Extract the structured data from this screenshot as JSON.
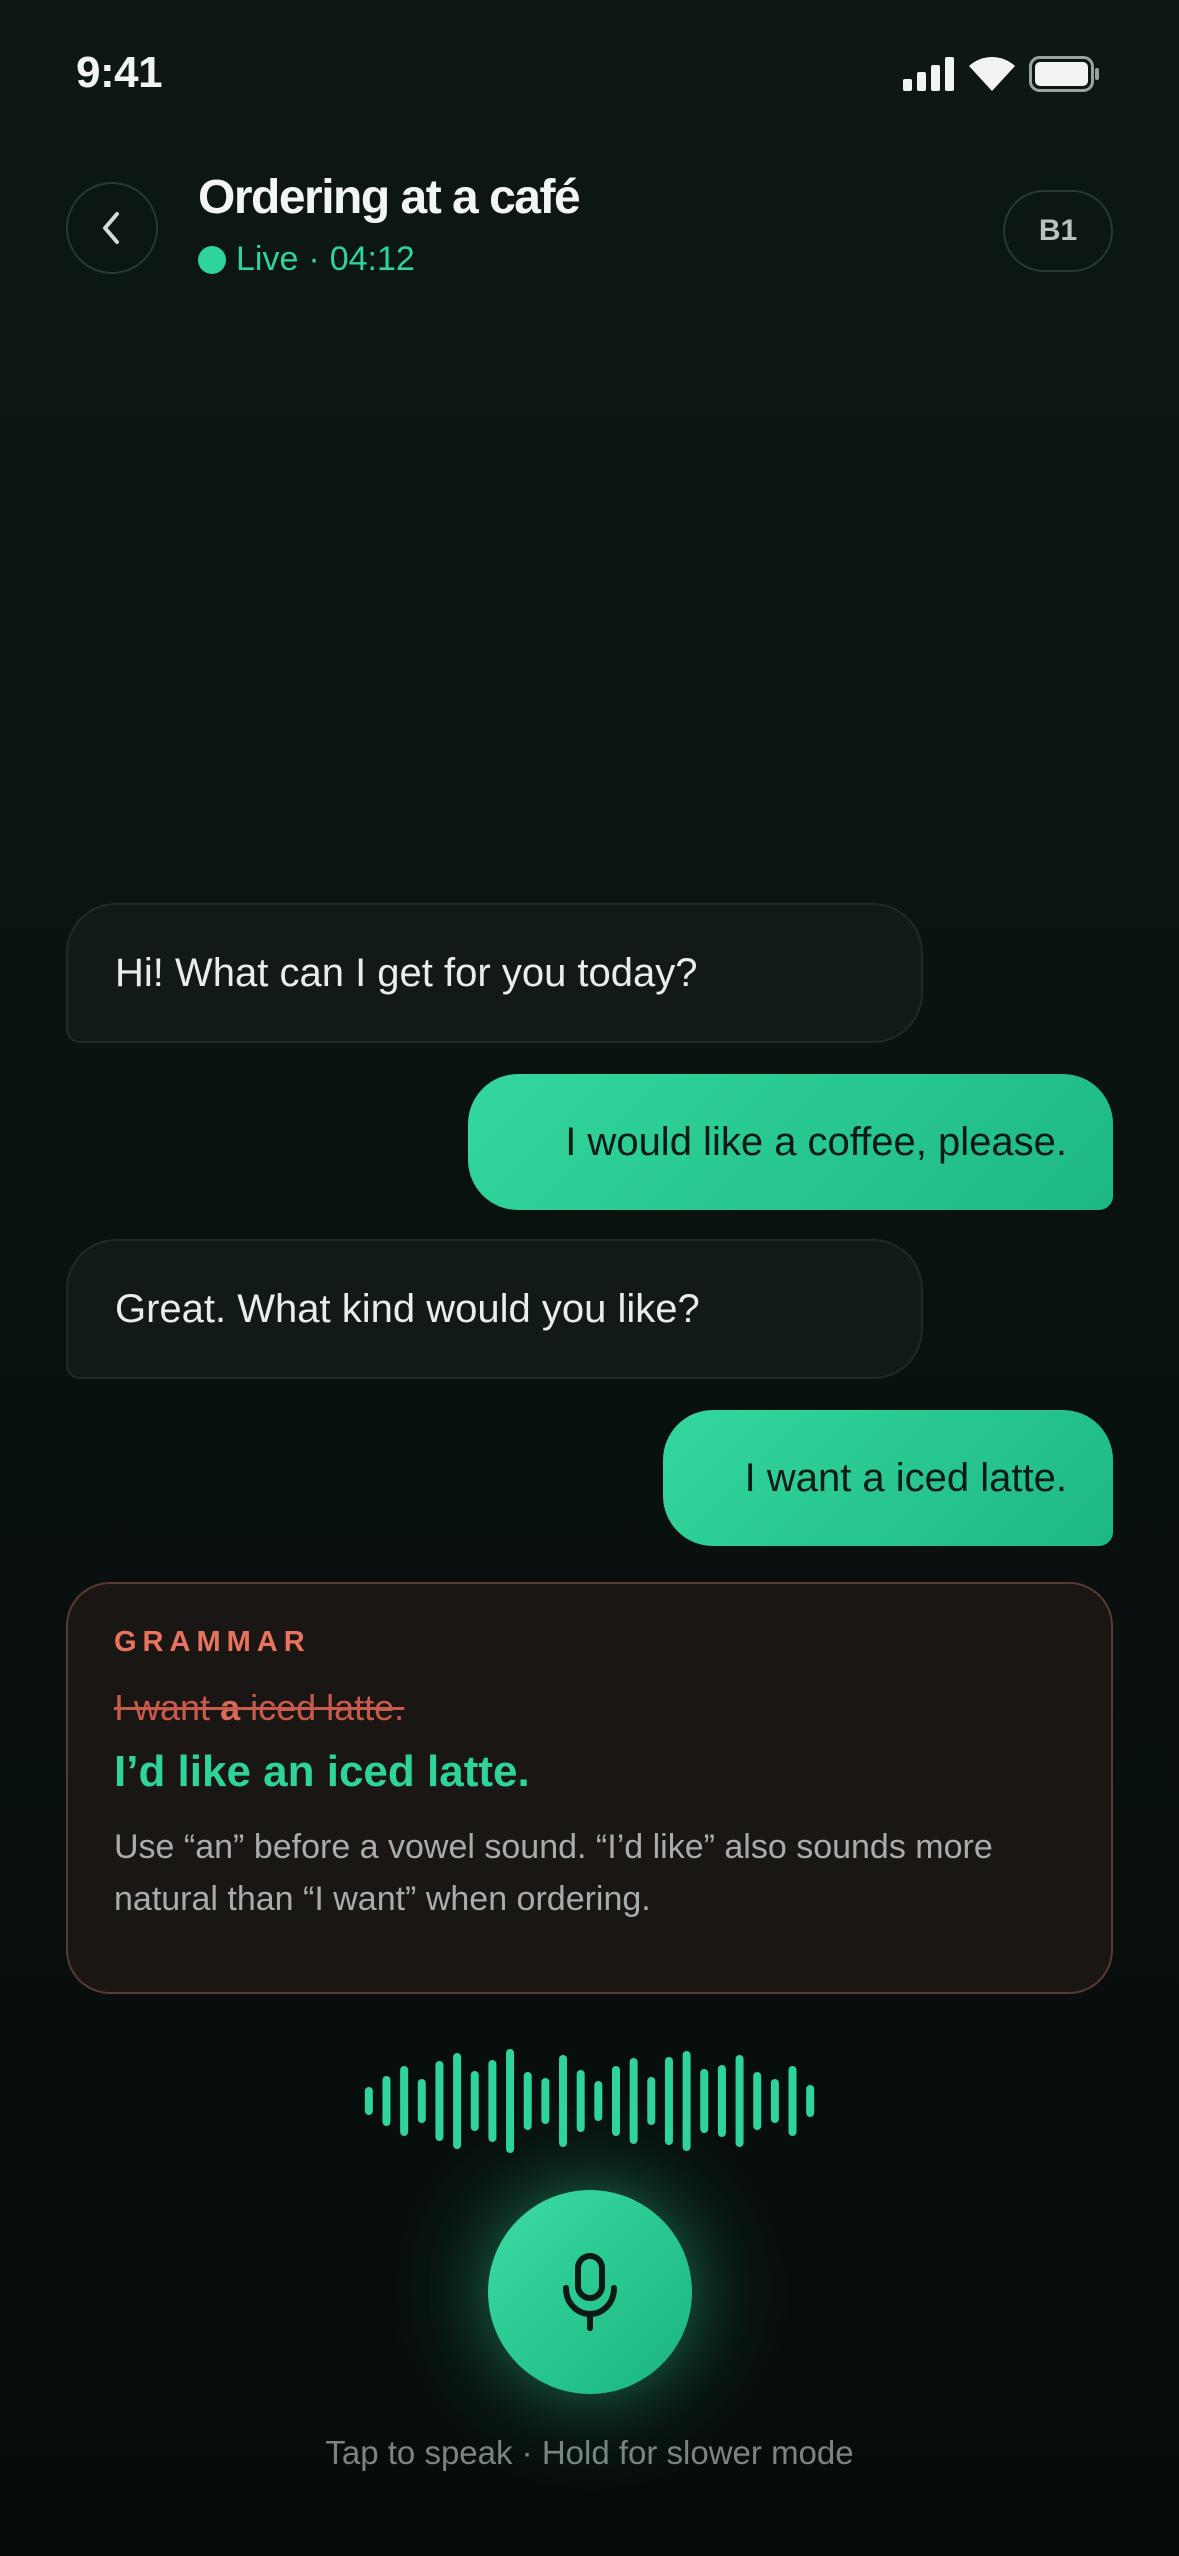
{
  "status_bar": {
    "time": "9:41"
  },
  "header": {
    "title": "Ordering at a café",
    "live_label": "Live",
    "separator": "·",
    "timer": "04:12",
    "level": "B1"
  },
  "messages": [
    {
      "role": "tutor",
      "text": "Hi! What can I get for you today?"
    },
    {
      "role": "user",
      "text": "I would like a coffee, please."
    },
    {
      "role": "tutor",
      "text": "Great. What kind would you like?"
    },
    {
      "role": "user",
      "text": "I want a iced latte."
    }
  ],
  "grammar": {
    "label": "GRAMMAR",
    "wrong_before": "I want ",
    "wrong_highlight": "a",
    "wrong_after": " iced latte.",
    "correction": "I’d like an iced latte.",
    "explanation_line1": "Use “an” before a vowel sound. “I’d like” also sounds more",
    "explanation_line2": "natural than “I want” when ordering."
  },
  "voice": {
    "hint": "Tap to speak · Hold for slower mode"
  },
  "colors": {
    "accent": "#2fd49a",
    "error": "#e8735e",
    "background": "#0a1210"
  },
  "icons": {
    "back": "chevron-left-icon",
    "mic": "microphone-icon",
    "signal": "cellular-signal-icon",
    "wifi": "wifi-icon",
    "battery": "battery-icon"
  }
}
